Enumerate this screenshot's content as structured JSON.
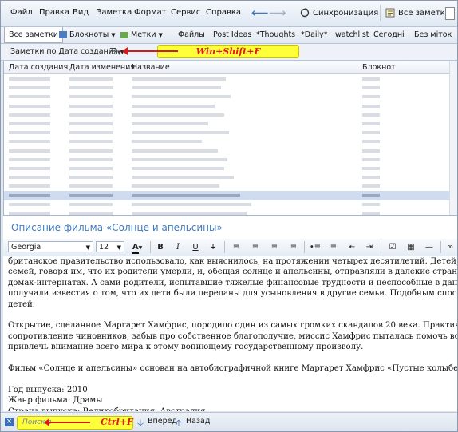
{
  "menu": [
    "Файл",
    "Правка",
    "Вид",
    "Заметка",
    "Формат",
    "Сервис",
    "Справка"
  ],
  "sync_label": "Синхронизация",
  "all_notes_label": "Все заметки",
  "tags": [
    "Все заметки",
    "Блокноты",
    "Метки",
    "Файлы",
    "Post Ideas",
    "*Thoughts",
    "*Daily*",
    "watchlist",
    "Сегодні",
    "Без міток"
  ],
  "sort_label": "Заметки по Дата создания",
  "columns": [
    "Дата создания",
    "Дата изменения",
    "Название",
    "Блокнот"
  ],
  "selected_row": 13,
  "rows_count": 16,
  "note_title": "Описание фильма «Солнце и апельсины»",
  "font_name": "Georgia",
  "font_size": "12",
  "body_lines": [
    "британское правительство использовало, как выяснилось, на протяжении четырех десятилетий. Детей, кот",
    "семей, говоря им, что их родители умерли, и, обещая солнце и апельсины, отправляли в далекие страны че",
    "домах-интернатах. А сами родители, испытавшие тяжелые финансовые трудности и неспособные в данн",
    "получали известия о том, что их дети были переданы для усыновления в другие семьи. Подобным способом",
    "детей.",
    "",
    "Открытие, сделанное Маргарет Хамфрис, породило один из самых громких скандалов 20 века. Практическ",
    "сопротивление чиновников, забыв про собственное благополучие, миссис Хамфрис пыталась помочь воссоед",
    "привлечь внимание всего мира к этому вопиющему государственному произволу.",
    "",
    "Фильм «Солнце и апельсины» основан на автобиографичной книге Маргарет Хамфрис «Пустые колыбели»",
    "",
    "Год выпуска: 2010",
    "Жанр фильма: Драмы",
    "Страна выпуска: Великобритания, Австралия"
  ],
  "find_placeholder": "Поиск в",
  "forward_label": "Вперед",
  "back_label": "Назад",
  "annotation_sort": "Win+Shift+F",
  "annotation_find": "Ctrl+F",
  "colors": {
    "accent": "#3e7bc0",
    "highlight": "#ffff3a",
    "annotation_text": "#e01818"
  }
}
